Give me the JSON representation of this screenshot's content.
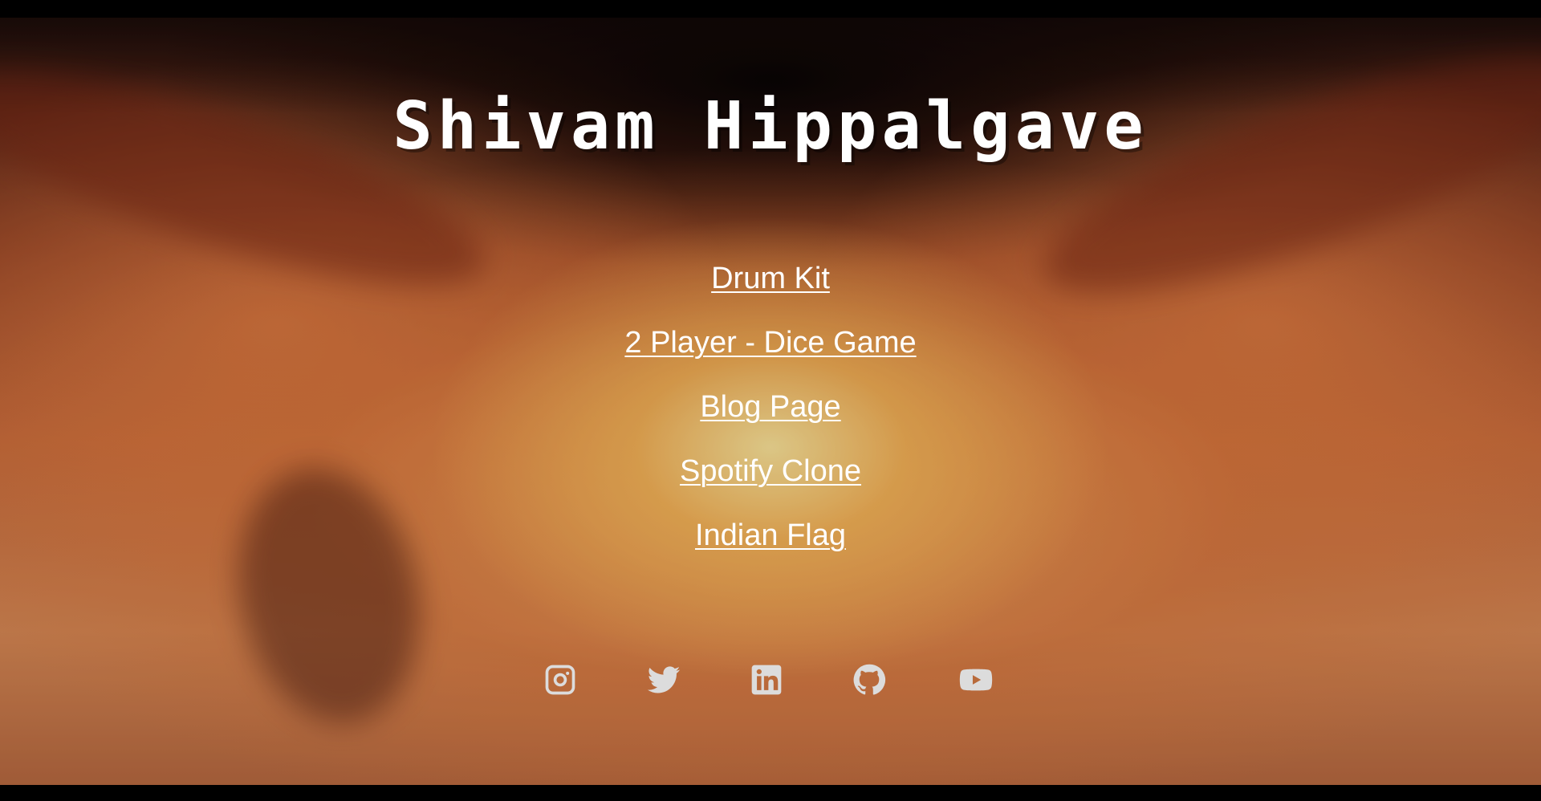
{
  "header": {
    "title": "Shivam Hippalgave"
  },
  "nav": {
    "links": [
      {
        "label": "Drum Kit"
      },
      {
        "label": "2 Player - Dice Game"
      },
      {
        "label": "Blog Page"
      },
      {
        "label": "Spotify Clone"
      },
      {
        "label": "Indian Flag"
      }
    ]
  },
  "social": {
    "icons": [
      "instagram-icon",
      "twitter-icon",
      "linkedin-icon",
      "github-icon",
      "youtube-icon"
    ],
    "icon_color": "#dcdcdc"
  },
  "colors": {
    "text": "#ffffff",
    "frame": "#000000"
  }
}
